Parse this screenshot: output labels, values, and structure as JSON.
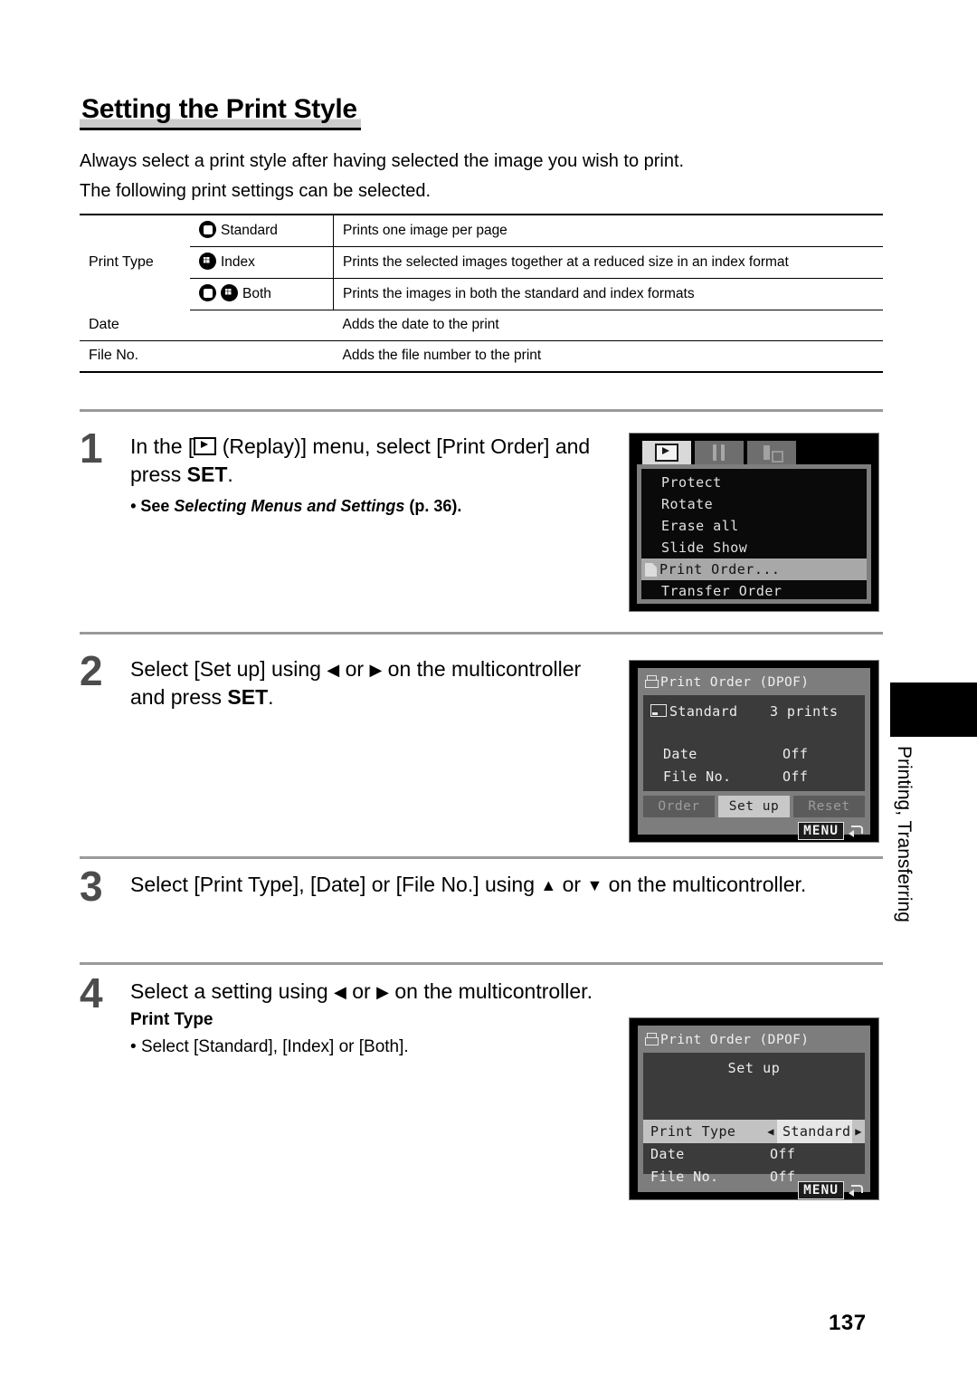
{
  "page": {
    "number": "137",
    "side_tab_label": "Printing, Transferring"
  },
  "heading": "Setting the Print Style",
  "intro": {
    "line1": "Always select a print style after having selected the image you wish to print.",
    "line2": "The following print settings can be selected."
  },
  "settings_table": {
    "print_type_label": "Print Type",
    "rows": [
      {
        "option": "Standard",
        "icon": "standard-icon",
        "description": "Prints one image per page"
      },
      {
        "option": "Index",
        "icon": "index-icon",
        "description": "Prints the selected images together at a reduced size in an index format"
      },
      {
        "option": "Both",
        "icon": "standard-and-index-icon",
        "description": "Prints the images in both the standard and index formats"
      }
    ],
    "date": {
      "label": "Date",
      "description": "Adds the date to the print"
    },
    "file_no": {
      "label": "File No.",
      "description": "Adds the file number to the print"
    }
  },
  "steps": [
    {
      "number": "1",
      "text_a": "In the [",
      "text_b": " (Replay)] menu, select [Print Order] and press ",
      "set": "SET",
      "text_c": ".",
      "sub_bullet_prefix": "See ",
      "sub_bullet_italic": "Selecting Menus and Settings",
      "sub_bullet_suffix": " (p. 36)."
    },
    {
      "number": "2",
      "text_a": "Select [Set up] using ",
      "left_arrow": "◀",
      "text_b": " or ",
      "right_arrow": "▶",
      "text_c": " on the multicontroller and press ",
      "set": "SET",
      "text_d": "."
    },
    {
      "number": "3",
      "text_a": "Select [Print Type], [Date] or [File No.] using ",
      "up_arrow": "▲",
      "text_b": " or ",
      "down_arrow": "▼",
      "text_c": " on the multicontroller."
    },
    {
      "number": "4",
      "text_a": "Select a setting using ",
      "left_arrow": "◀",
      "text_b": " or ",
      "right_arrow": "▶",
      "text_c": " on the multicontroller.",
      "bold_head": "Print Type",
      "bullet": "Select [Standard], [Index] or [Both]."
    }
  ],
  "lcd_menu": {
    "tabs": [
      {
        "name": "playback-tab",
        "active": true
      },
      {
        "name": "setup-tab",
        "active": false
      },
      {
        "name": "my-camera-tab",
        "active": false
      }
    ],
    "items": [
      {
        "label": "Protect",
        "selected": false
      },
      {
        "label": "Rotate",
        "selected": false
      },
      {
        "label": "Erase all",
        "selected": false
      },
      {
        "label": "Slide Show",
        "selected": false
      },
      {
        "label": "Print Order...",
        "selected": true
      },
      {
        "label": "Transfer Order",
        "selected": false
      }
    ]
  },
  "lcd_print_order": {
    "title": "Print Order (DPOF)",
    "rows": [
      {
        "label": "Standard",
        "value": "3 prints",
        "icon": "standard-icon"
      },
      {
        "label": "Date",
        "value": "Off",
        "icon": ""
      },
      {
        "label": "File No.",
        "value": "Off",
        "icon": ""
      }
    ],
    "buttons": [
      {
        "label": "Order",
        "active": false
      },
      {
        "label": "Set up",
        "active": true
      },
      {
        "label": "Reset",
        "active": false
      }
    ],
    "menu_button": "MENU"
  },
  "lcd_setup": {
    "title": "Print Order (DPOF)",
    "heading": "Set up",
    "selected_row": {
      "label": "Print Type",
      "value": "Standard",
      "left_arrow": "◀",
      "right_arrow": "▶"
    },
    "rows": [
      {
        "label": "Date",
        "value": "Off"
      },
      {
        "label": "File No.",
        "value": "Off"
      }
    ],
    "menu_button": "MENU"
  }
}
